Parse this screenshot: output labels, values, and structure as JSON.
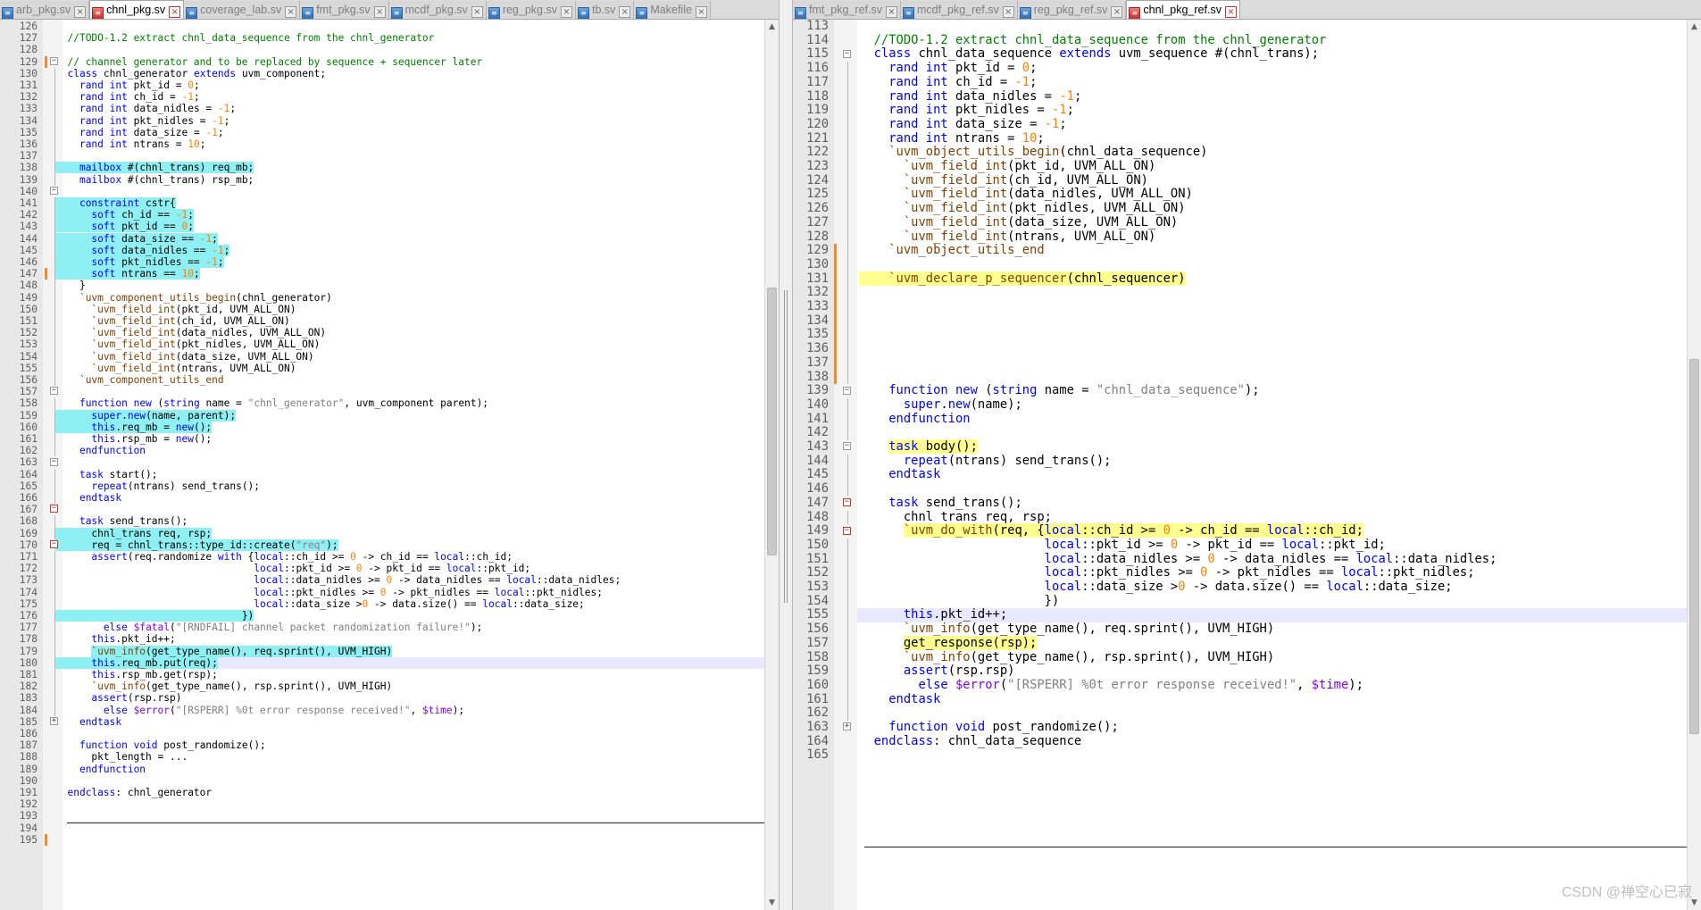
{
  "left_tabs": [
    {
      "label": "arb_pkg.sv",
      "active": false
    },
    {
      "label": "chnl_pkg.sv",
      "active": true
    },
    {
      "label": "coverage_lab.sv",
      "active": false
    },
    {
      "label": "fmt_pkg.sv",
      "active": false
    },
    {
      "label": "mcdf_pkg.sv",
      "active": false
    },
    {
      "label": "reg_pkg.sv",
      "active": false
    },
    {
      "label": "tb.sv",
      "active": false
    },
    {
      "label": "Makefile",
      "active": false
    }
  ],
  "right_tabs": [
    {
      "label": "fmt_pkg_ref.sv",
      "active": false
    },
    {
      "label": "mcdf_pkg_ref.sv",
      "active": false
    },
    {
      "label": "reg_pkg_ref.sv",
      "active": false
    },
    {
      "label": "chnl_pkg_ref.sv",
      "active": true
    }
  ],
  "left_code": {
    "first_line": 126,
    "lines": [
      "",
      "  //TODO-1.2 extract chnl_data_sequence from the chnl_generator",
      "",
      "  // channel generator and to be replaced by sequence + sequencer later",
      "  class chnl_generator extends uvm_component;",
      "    rand int pkt_id = 0;",
      "    rand int ch_id = -1;",
      "    rand int data_nidles = -1;",
      "    rand int pkt_nidles = -1;",
      "    rand int data_size = -1;",
      "    rand int ntrans = 10;",
      "",
      "    mailbox #(chnl_trans) req_mb;",
      "    mailbox #(chnl_trans) rsp_mb;",
      "",
      "    constraint cstr{",
      "      soft ch_id == -1;",
      "      soft pkt_id == 0;",
      "      soft data_size == -1;",
      "      soft data_nidles == -1;",
      "      soft pkt_nidles == -1;",
      "      soft ntrans == 10;",
      "    }",
      "    `uvm_component_utils_begin(chnl_generator)",
      "      `uvm_field_int(pkt_id, UVM_ALL_ON)",
      "      `uvm_field_int(ch_id, UVM_ALL_ON)",
      "      `uvm_field_int(data_nidles, UVM_ALL_ON)",
      "      `uvm_field_int(pkt_nidles, UVM_ALL_ON)",
      "      `uvm_field_int(data_size, UVM_ALL_ON)",
      "      `uvm_field_int(ntrans, UVM_ALL_ON)",
      "    `uvm_component_utils_end",
      "",
      "    function new (string name = \"chnl_generator\", uvm_component parent);",
      "      super.new(name, parent);",
      "      this.req_mb = new();",
      "      this.rsp_mb = new();",
      "    endfunction",
      "",
      "    task start();",
      "      repeat(ntrans) send_trans();",
      "    endtask",
      "",
      "    task send_trans();",
      "      chnl_trans req, rsp;",
      "      req = chnl_trans::type_id::create(\"req\");",
      "      assert(req.randomize with {local::ch_id >= 0 -> ch_id == local::ch_id;",
      "                                 local::pkt_id >= 0 -> pkt_id == local::pkt_id;",
      "                                 local::data_nidles >= 0 -> data_nidles == local::data_nidles;",
      "                                 local::pkt_nidles >= 0 -> pkt_nidles == local::pkt_nidles;",
      "                                 local::data_size >0 -> data.size() == local::data_size;",
      "                               })",
      "        else $fatal(\"[RNDFAIL] channel packet randomization failure!\");",
      "      this.pkt_id++;",
      "      `uvm_info(get_type_name(), req.sprint(), UVM_HIGH)",
      "      this.req_mb.put(req);",
      "      this.rsp_mb.get(rsp);",
      "      `uvm_info(get_type_name(), rsp.sprint(), UVM_HIGH)",
      "      assert(rsp.rsp)",
      "        else $error(\"[RSPERR] %0t error response received!\", $time);",
      "    endtask",
      "",
      "    function void post_randomize();",
      "      pkt_length = ...",
      "    endfunction",
      "",
      "  endclass: chnl_generator",
      "",
      "",
      "",
      ""
    ]
  },
  "right_code": {
    "first_line": 113,
    "lines": [
      "",
      "  //TODO-1.2 extract chnl_data_sequence from the chnl_generator",
      "  class chnl_data_sequence extends uvm_sequence #(chnl_trans);",
      "    rand int pkt_id = 0;",
      "    rand int ch_id = -1;",
      "    rand int data_nidles = -1;",
      "    rand int pkt_nidles = -1;",
      "    rand int data_size = -1;",
      "    rand int ntrans = 10;",
      "    `uvm_object_utils_begin(chnl_data_sequence)",
      "      `uvm_field_int(pkt_id, UVM_ALL_ON)",
      "      `uvm_field_int(ch_id, UVM_ALL_ON)",
      "      `uvm_field_int(data_nidles, UVM_ALL_ON)",
      "      `uvm_field_int(pkt_nidles, UVM_ALL_ON)",
      "      `uvm_field_int(data_size, UVM_ALL_ON)",
      "      `uvm_field_int(ntrans, UVM_ALL_ON)",
      "    `uvm_object_utils_end",
      "",
      "    `uvm_declare_p_sequencer(chnl_sequencer)",
      "",
      "",
      "",
      "",
      "",
      "",
      "",
      "    function new (string name = \"chnl_data_sequence\");",
      "      super.new(name);",
      "    endfunction",
      "",
      "    task body();",
      "      repeat(ntrans) send_trans();",
      "    endtask",
      "",
      "    task send_trans();",
      "      chnl_trans req, rsp;",
      "      `uvm_do_with(req, {local::ch_id >= 0 -> ch_id == local::ch_id;",
      "                         local::pkt_id >= 0 -> pkt_id == local::pkt_id;",
      "                         local::data_nidles >= 0 -> data_nidles == local::data_nidles;",
      "                         local::pkt_nidles >= 0 -> pkt_nidles == local::pkt_nidles;",
      "                         local::data_size >0 -> data.size() == local::data_size;",
      "                         })",
      "      this.pkt_id++;",
      "      `uvm_info(get_type_name(), req.sprint(), UVM_HIGH)",
      "      get_response(rsp);",
      "      `uvm_info(get_type_name(), rsp.sprint(), UVM_HIGH)",
      "      assert(rsp.rsp)",
      "        else $error(\"[RSPERR] %0t error response received!\", $time);",
      "    endtask",
      "",
      "    function void post_randomize();",
      "  endclass: chnl_data_sequence",
      ""
    ]
  },
  "watermark": "CSDN @禅空心已寂",
  "colors": {
    "keyword": "#0000ff",
    "comment": "#008000",
    "string": "#808080",
    "number": "#ff8000",
    "macro": "#804000",
    "sysvar": "#8000ff",
    "highlight_cyan": "#8ff0f4",
    "highlight_yellow": "#ffff90",
    "current_line": "#e8e8ff"
  }
}
